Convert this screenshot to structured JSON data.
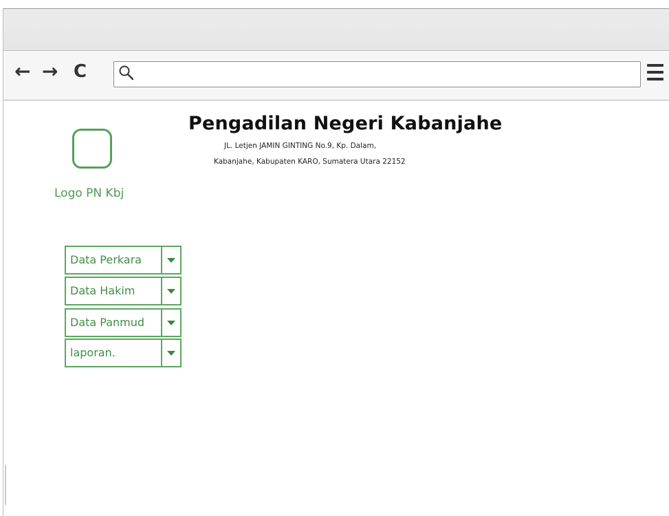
{
  "browser": {
    "nav": {
      "back_glyph": "←",
      "forward_glyph": "→",
      "reload_glyph": "C"
    },
    "address": {
      "value": "",
      "placeholder": ""
    },
    "icons": [
      "back-arrow-icon",
      "forward-arrow-icon",
      "reload-icon",
      "search-icon",
      "hamburger-menu-icon"
    ]
  },
  "header": {
    "title": "Pengadilan Negeri Kabanjahe",
    "address_line_1": "JL. Letjen JAMIN GINTING No.9, Kp. Dalam,",
    "address_line_2": "Kabanjahe, Kabupaten KARO, Sumatera Utara 22152"
  },
  "logo": {
    "label": "Logo PN Kbj"
  },
  "menu": {
    "items": [
      {
        "label": "Data Perkara"
      },
      {
        "label": "Data Hakim"
      },
      {
        "label": "Data Panmud"
      },
      {
        "label": "laporan."
      }
    ]
  },
  "colors": {
    "accent_green": "#5aa75d",
    "text_green": "#3f8f43",
    "border_gray": "#b5b5b5"
  }
}
